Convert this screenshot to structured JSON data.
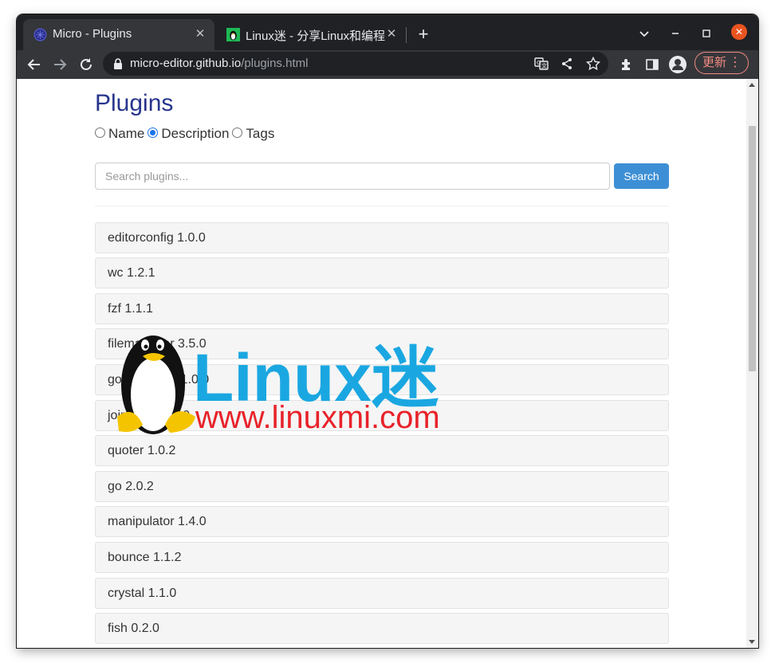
{
  "browser": {
    "tabs": [
      {
        "title": "Micro - Plugins",
        "active": true,
        "icon": "micro-favicon"
      },
      {
        "title": "Linux迷 - 分享Linux和编程",
        "active": false,
        "icon": "linuxmi-favicon"
      }
    ],
    "url_host": "micro-editor.github.io",
    "url_path": "/plugins.html",
    "update_label": "更新",
    "colors": {
      "frame": "#202124",
      "toolbar": "#35363a",
      "update": "#f28b82",
      "close": "#e95420"
    }
  },
  "page": {
    "title": "Plugins",
    "filter_options": [
      {
        "label": "Name",
        "checked": false
      },
      {
        "label": "Description",
        "checked": true
      },
      {
        "label": "Tags",
        "checked": false
      }
    ],
    "search_placeholder": "Search plugins...",
    "search_button": "Search",
    "plugins": [
      "editorconfig 1.0.0",
      "wc 1.2.1",
      "fzf 1.1.1",
      "filemanager 3.5.0",
      "gotemplates 1.0.0",
      "joinLines 1.0.0",
      "quoter 1.0.2",
      "go 2.0.2",
      "manipulator 1.4.0",
      "bounce 1.1.2",
      "crystal 1.1.0",
      "fish 0.2.0"
    ],
    "colors": {
      "title": "#27358d",
      "button": "#3d8fd5"
    }
  },
  "watermark": {
    "brand": "Linux迷",
    "url": "www.linuxmi.com"
  }
}
